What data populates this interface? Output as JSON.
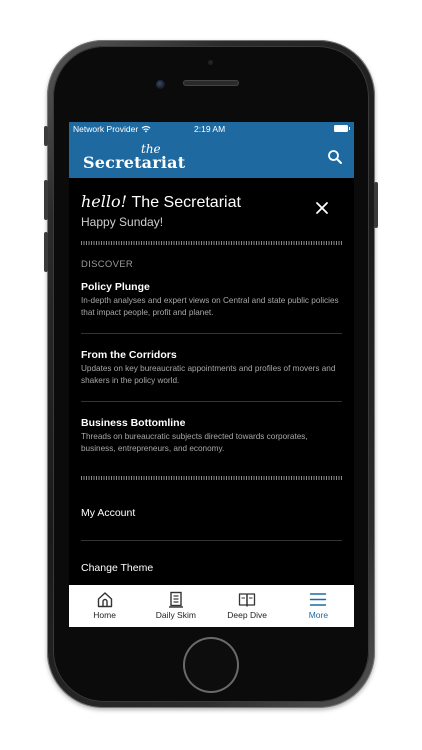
{
  "status_bar": {
    "provider": "Network Provider",
    "time": "2:19 AM"
  },
  "header": {
    "logo_the": "the",
    "logo_name": "Secretariat",
    "search_icon": "search-icon"
  },
  "greeting": {
    "hello": "hello!",
    "brand": "The Secretariat",
    "subtitle": "Happy Sunday!",
    "close_icon": "close-icon"
  },
  "discover": {
    "label": "DISCOVER",
    "items": [
      {
        "title": "Policy Plunge",
        "description": "In-depth analyses and expert views on Central and state public policies that impact people, profit and planet."
      },
      {
        "title": "From the Corridors",
        "description": "Updates on key bureaucratic appointments and profiles of movers and shakers in the policy world."
      },
      {
        "title": "Business Bottomline",
        "description": "Threads on bureaucratic subjects directed towards corporates, business, entrepreneurs, and economy."
      }
    ]
  },
  "account": {
    "my_account": "My Account",
    "change_theme": "Change Theme"
  },
  "tabs": [
    {
      "label": "Home",
      "icon": "home-icon",
      "active": false
    },
    {
      "label": "Daily Skim",
      "icon": "document-icon",
      "active": false
    },
    {
      "label": "Deep Dive",
      "icon": "book-icon",
      "active": false
    },
    {
      "label": "More",
      "icon": "menu-icon",
      "active": true
    }
  ],
  "colors": {
    "brand_blue": "#1e6aa0",
    "screen_bg": "#000000",
    "tab_bar_bg": "#ffffff"
  }
}
